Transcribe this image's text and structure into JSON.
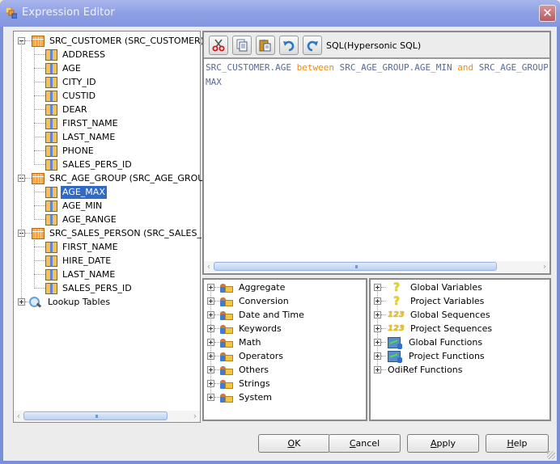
{
  "window": {
    "title": "Expression Editor",
    "close_label": "✕"
  },
  "source_tree": {
    "groups": [
      {
        "label": "SRC_CUSTOMER (SRC_CUSTOMER)",
        "expanded": true,
        "columns": [
          "ADDRESS",
          "AGE",
          "CITY_ID",
          "CUSTID",
          "DEAR",
          "FIRST_NAME",
          "LAST_NAME",
          "PHONE",
          "SALES_PERS_ID"
        ]
      },
      {
        "label": "SRC_AGE_GROUP (SRC_AGE_GROUP)",
        "expanded": true,
        "columns": [
          "AGE_MAX",
          "AGE_MIN",
          "AGE_RANGE"
        ]
      },
      {
        "label": "SRC_SALES_PERSON (SRC_SALES_PERSON)",
        "expanded": true,
        "columns": [
          "FIRST_NAME",
          "HIRE_DATE",
          "LAST_NAME",
          "SALES_PERS_ID"
        ]
      }
    ],
    "selected": "AGE_MAX",
    "lookup_label": "Lookup Tables"
  },
  "toolbar": {
    "buttons": [
      {
        "name": "cut",
        "icon": "scissors-icon"
      },
      {
        "name": "copy",
        "icon": "copy-icon"
      },
      {
        "name": "paste",
        "icon": "paste-icon"
      },
      {
        "name": "undo",
        "icon": "undo-icon"
      },
      {
        "name": "redo",
        "icon": "redo-icon"
      }
    ],
    "dialect": "SQL(Hypersonic SQL)"
  },
  "editor": {
    "tokens": [
      {
        "text": "SRC_CUSTOMER.AGE ",
        "type": "ident"
      },
      {
        "text": "between",
        "type": "keyword"
      },
      {
        "text": " SRC_AGE_GROUP.AGE_MIN ",
        "type": "ident"
      },
      {
        "text": "and",
        "type": "keyword"
      },
      {
        "text": " SRC_AGE_GROUP.AGE_",
        "type": "ident"
      }
    ],
    "line2": "MAX",
    "colors": {
      "ident": "#5a6a94",
      "keyword": "#f08a14"
    }
  },
  "functions": {
    "items": [
      "Aggregate",
      "Conversion",
      "Date and Time",
      "Keywords",
      "Math",
      "Operators",
      "Others",
      "Strings",
      "System"
    ]
  },
  "variables": {
    "items": [
      {
        "label": "Global Variables",
        "icon": "question-icon"
      },
      {
        "label": "Project Variables",
        "icon": "question-icon"
      },
      {
        "label": "Global Sequences",
        "icon": "sequence-icon"
      },
      {
        "label": "Project Sequences",
        "icon": "sequence-icon"
      },
      {
        "label": "Global Functions",
        "icon": "function-icon"
      },
      {
        "label": "Project Functions",
        "icon": "function-icon"
      },
      {
        "label": "OdiRef Functions",
        "icon": "none"
      }
    ]
  },
  "buttons": {
    "ok": {
      "mnemonic": "O",
      "rest": "K"
    },
    "cancel": {
      "mnemonic": "C",
      "rest": "ancel"
    },
    "apply": {
      "mnemonic": "A",
      "rest": "pply"
    },
    "help": {
      "mnemonic": "H",
      "rest": "elp"
    }
  }
}
